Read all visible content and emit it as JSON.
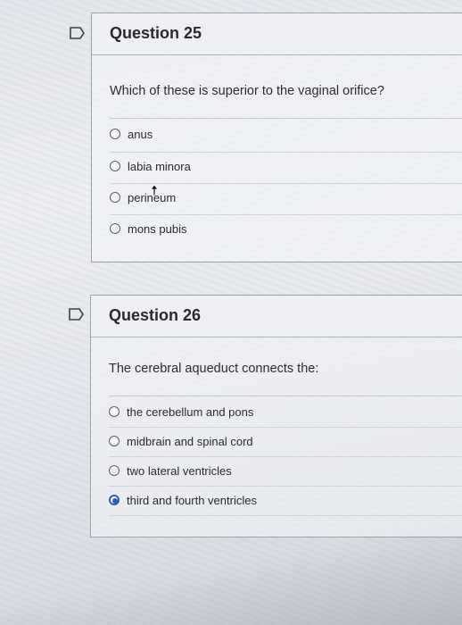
{
  "questions": [
    {
      "title": "Question 25",
      "prompt": "Which of these is superior to the vaginal orifice?",
      "options": [
        "anus",
        "labia minora",
        "perineum",
        "mons pubis"
      ],
      "selected": null
    },
    {
      "title": "Question 26",
      "prompt": "The cerebral aqueduct connects the:",
      "options": [
        "the cerebellum and pons",
        "midbrain and spinal cord",
        "two lateral ventricles",
        "third and fourth ventricles"
      ],
      "selected": "third and fourth ventricles"
    }
  ],
  "colors": {
    "selected_radio": "#2b5db3",
    "card_border": "#9da1aa"
  },
  "icons": {
    "flag": "flag-icon",
    "cursor": "mouse-cursor-icon"
  }
}
